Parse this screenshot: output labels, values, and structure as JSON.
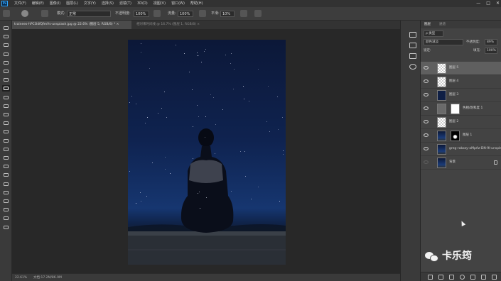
{
  "app": {
    "logo": "Ps"
  },
  "menu": [
    "文件(F)",
    "编辑(E)",
    "图像(I)",
    "图层(L)",
    "文字(Y)",
    "选择(S)",
    "滤镜(T)",
    "3D(D)",
    "视图(V)",
    "窗口(W)",
    "帮助(H)"
  ],
  "window_controls": {
    "minimize": "—",
    "maximize": "□",
    "close": "✕"
  },
  "options_bar": {
    "mode_label": "模式:",
    "mode_value": "正常",
    "opacity_label": "不透明度:",
    "opacity_value": "100%",
    "flow_label": "流量:",
    "flow_value": "100%",
    "smooth_label": "平滑:",
    "smooth_value": "10%"
  },
  "tabs": [
    {
      "label": "trainees-hPCO4fQfmVs-unsplash.jpg @ 22.6% (图层 5, RGB/8) *  ×"
    },
    {
      "label": "相对来时间线 @ 16.7% (图层 1, RGB/8)  ×"
    }
  ],
  "status": {
    "zoom": "22.61%",
    "doc": "文档:17.2M/86.9M"
  },
  "panel": {
    "tabs": [
      "图层",
      "通道"
    ],
    "kind": "ρ 类型",
    "blend": "颜色减淡",
    "opacity_label": "不透明度:",
    "opacity_value": "89%",
    "lock_label": "锁定:",
    "fill_label": "填充:",
    "fill_value": "100%",
    "layers": [
      {
        "name": "图层 5",
        "selected": true
      },
      {
        "name": "图层 4",
        "selected": false
      },
      {
        "name": "图层 3",
        "selected": false
      },
      {
        "name": "色相/饱和度 1",
        "selected": false
      },
      {
        "name": "图层 2",
        "selected": false
      },
      {
        "name": "图层 1",
        "selected": false
      },
      {
        "name": "greg-rakozy-oMpAz-DN-9I-unsplash",
        "selected": false
      },
      {
        "name": "背景",
        "selected": false
      }
    ]
  },
  "watermark": "卡乐筠",
  "colors": {
    "accent": "#31a8ff",
    "panel": "#434343",
    "canvas": "#282828"
  }
}
